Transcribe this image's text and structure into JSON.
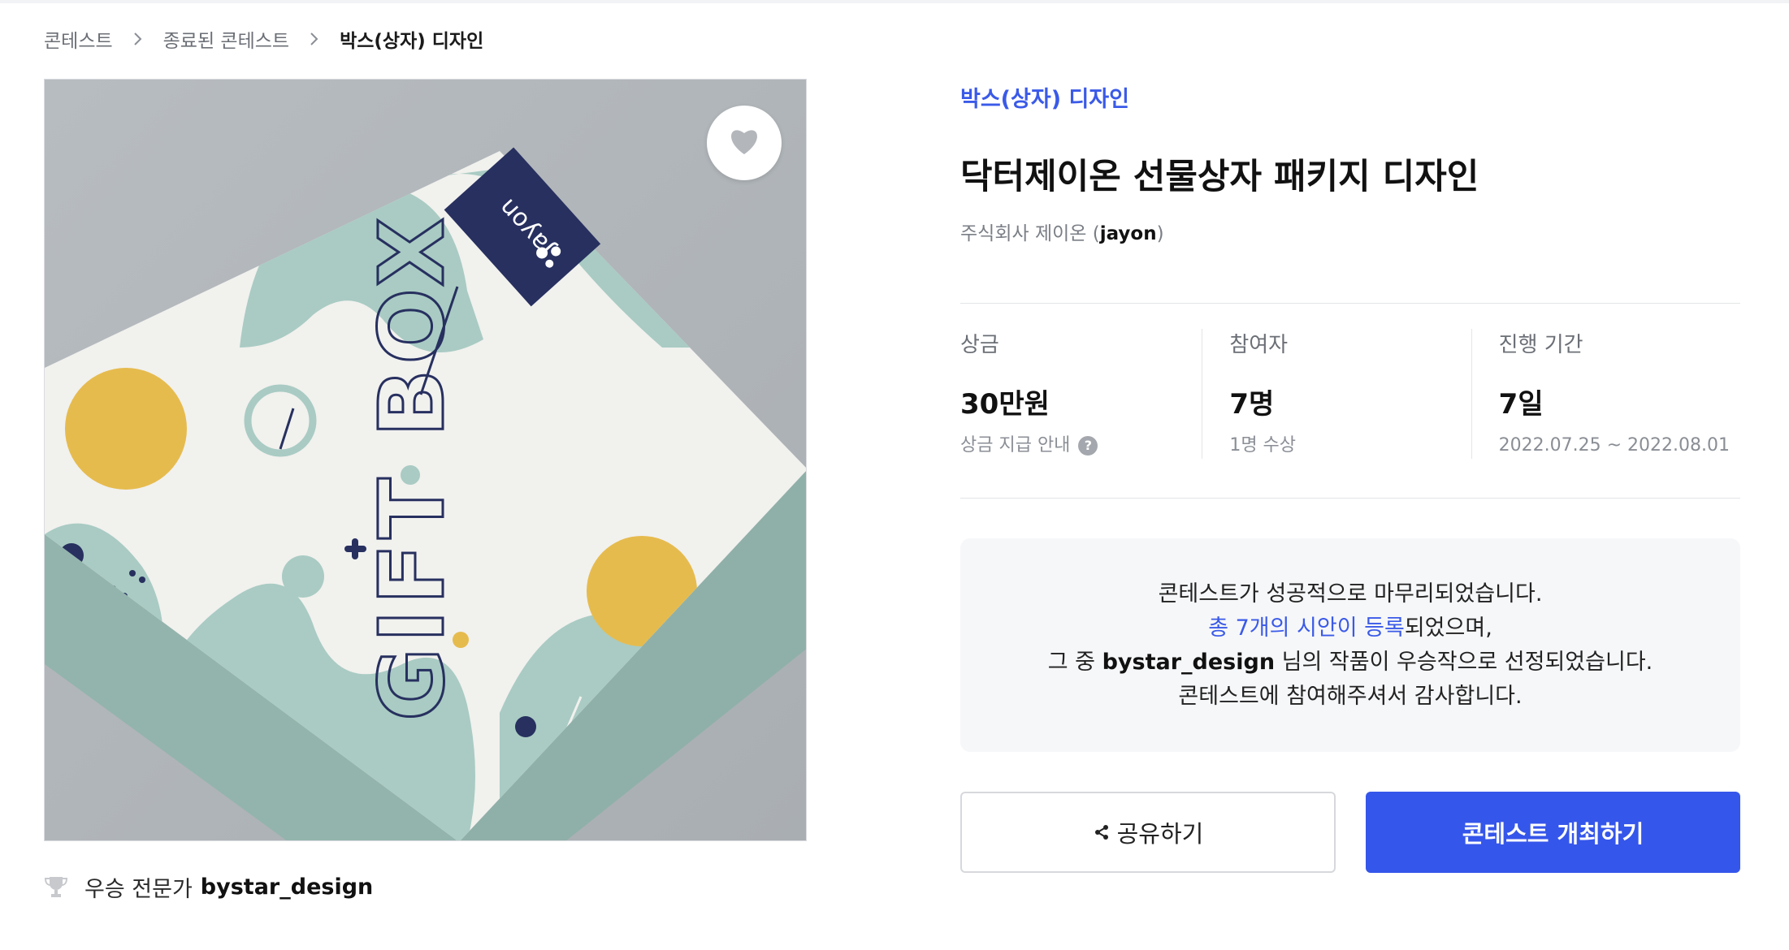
{
  "breadcrumb": {
    "items": [
      "콘테스트",
      "종료된 콘테스트",
      "박스(상자) 디자인"
    ]
  },
  "image": {
    "brand_logo_text": "Jayon",
    "box_text": "GIFT BOX"
  },
  "winner": {
    "label": "우승 전문가",
    "name": "bystar_design"
  },
  "contest": {
    "category": "박스(상자) 디자인",
    "title": "닥터제이온 선물상자 패키지 디자인",
    "host_name": "주식회사 제이온",
    "host_id": "jayon"
  },
  "stats": [
    {
      "label": "상금",
      "value": "30만원",
      "sub": "상금 지급 안내"
    },
    {
      "label": "참여자",
      "value": "7명",
      "sub": "1명 수상"
    },
    {
      "label": "진행 기간",
      "value": "7일",
      "sub": "2022.07.25 ~ 2022.08.01"
    }
  ],
  "notice": {
    "line1": "콘테스트가 성공적으로 마무리되었습니다.",
    "line2_link": "총 7개의 시안이 등록",
    "line2_rest": "되었으며,",
    "line3_pre": "그 중 ",
    "line3_name": "bystar_design",
    "line3_post": " 님의 작품이 우승작으로 선정되었습니다.",
    "line4": "콘테스트에 참여해주셔서 감사합니다."
  },
  "buttons": {
    "share": "공유하기",
    "host": "콘테스트 개최하기"
  },
  "colors": {
    "accent": "#3a5ae8",
    "primary_button": "#3556ea",
    "box_mint": "#a9cbc3",
    "box_yellow": "#e6bb4e",
    "box_navy": "#27305f"
  },
  "icons": [
    "chevron-right-icon",
    "heart-icon",
    "trophy-icon",
    "help-icon",
    "share-icon"
  ]
}
